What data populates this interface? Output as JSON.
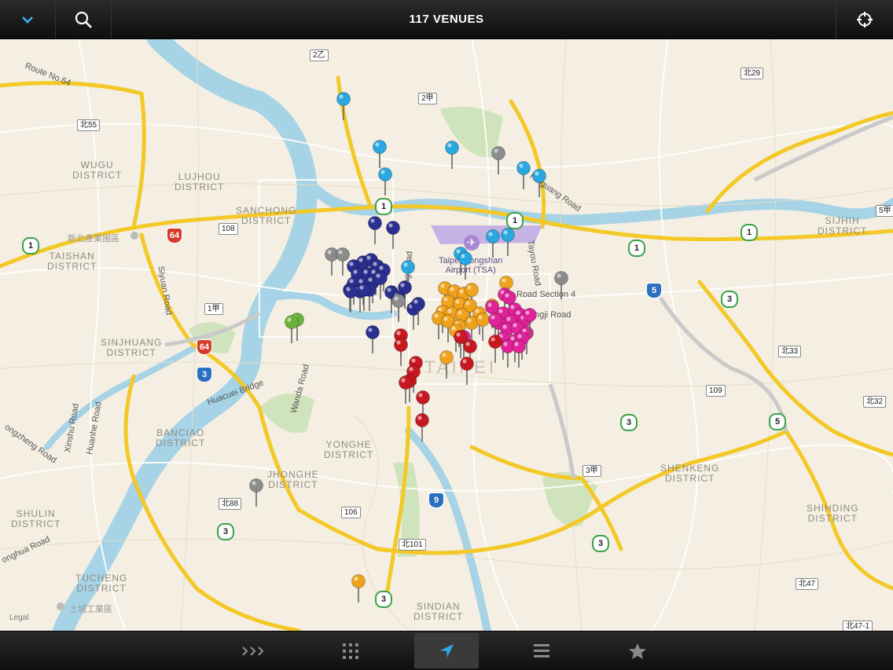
{
  "header": {
    "title": "117 VENUES"
  },
  "map": {
    "legal": "Legal",
    "city_label": "TAIPEI",
    "districts": [
      {
        "id": "wugu",
        "lines": [
          "WUGU",
          "DISTRICT"
        ]
      },
      {
        "id": "lujhou",
        "lines": [
          "LUJHOU",
          "DISTRICT"
        ]
      },
      {
        "id": "sanchong",
        "lines": [
          "SANCHONG",
          "DISTRICT"
        ]
      },
      {
        "id": "taishan",
        "lines": [
          "TAISHAN",
          "DISTRICT"
        ]
      },
      {
        "id": "sinjhuang",
        "lines": [
          "SINJHUANG",
          "DISTRICT"
        ]
      },
      {
        "id": "banciao",
        "lines": [
          "BANCIAO",
          "DISTRICT"
        ]
      },
      {
        "id": "yonghe",
        "lines": [
          "YONGHE",
          "DISTRICT"
        ]
      },
      {
        "id": "jhonghe",
        "lines": [
          "JHONGHE",
          "DISTRICT"
        ]
      },
      {
        "id": "shulin",
        "lines": [
          "SHULIN",
          "DISTRICT"
        ]
      },
      {
        "id": "tucheng",
        "lines": [
          "TUCHENG",
          "DISTRICT"
        ]
      },
      {
        "id": "sindian",
        "lines": [
          "SINDIAN",
          "DISTRICT"
        ]
      },
      {
        "id": "shenkeng",
        "lines": [
          "SHENKENG",
          "DISTRICT"
        ]
      },
      {
        "id": "shihding",
        "lines": [
          "SHIHDING",
          "DISTRICT"
        ]
      },
      {
        "id": "sijhih",
        "lines": [
          "SIJHIH",
          "DISTRICT"
        ]
      }
    ],
    "roads": [
      {
        "id": "route64",
        "text": "Route No.64"
      },
      {
        "id": "siyuan",
        "text": "Siyuan Road"
      },
      {
        "id": "huacuei",
        "text": "Huacuei Bridge"
      },
      {
        "id": "wanda",
        "text": "Wanda Road"
      },
      {
        "id": "xinshu",
        "text": "Xinshu Road"
      },
      {
        "id": "huanhe",
        "text": "Huanhe Road"
      },
      {
        "id": "zhongzheng",
        "text": "ongzheng Road"
      },
      {
        "id": "jinghua",
        "text": "onghua Road"
      },
      {
        "id": "ruiguang",
        "text": "Ruiguang Road"
      },
      {
        "id": "tayou",
        "text": "Tayou Road"
      },
      {
        "id": "linsen",
        "text": "ling Road"
      },
      {
        "id": "road_sec4",
        "text": "Road Section 4"
      },
      {
        "id": "zhongji",
        "text": "ngji Road"
      }
    ],
    "airport": {
      "line1": "Taipei Songshan",
      "line2": "Airport (TSA)"
    },
    "pois": [
      {
        "id": "poi1",
        "text": "新北產業園區"
      },
      {
        "id": "poi2",
        "text": "土城工業區"
      }
    ],
    "shields": [
      {
        "id": "s2yi",
        "text": "2乙"
      },
      {
        "id": "s2jia",
        "text": "2甲"
      },
      {
        "id": "sbei29",
        "text": "北29"
      },
      {
        "id": "sbei55",
        "text": "北55"
      },
      {
        "id": "s108",
        "text": "108"
      },
      {
        "id": "s1jia",
        "text": "1甲"
      },
      {
        "id": "s5jia",
        "text": "5甲"
      },
      {
        "id": "sbei33",
        "text": "北33"
      },
      {
        "id": "s109",
        "text": "109"
      },
      {
        "id": "sbei32",
        "text": "北32"
      },
      {
        "id": "s3jia",
        "text": "3甲"
      },
      {
        "id": "sbei88",
        "text": "北88"
      },
      {
        "id": "s106",
        "text": "106"
      },
      {
        "id": "sbei101",
        "text": "北101"
      },
      {
        "id": "sbei47",
        "text": "北47"
      },
      {
        "id": "sbei471",
        "text": "北47-1"
      }
    ],
    "route_markers": [
      {
        "id": "r1a",
        "text": "1",
        "kind": "flower"
      },
      {
        "id": "r1b",
        "text": "1",
        "kind": "flower"
      },
      {
        "id": "r1c",
        "text": "1",
        "kind": "flower"
      },
      {
        "id": "r1d",
        "text": "1",
        "kind": "flower"
      },
      {
        "id": "r1e",
        "text": "1",
        "kind": "flower"
      },
      {
        "id": "r3a",
        "text": "3",
        "kind": "flower"
      },
      {
        "id": "r3b",
        "text": "3",
        "kind": "flower"
      },
      {
        "id": "r3c",
        "text": "3",
        "kind": "flower"
      },
      {
        "id": "r3d",
        "text": "3",
        "kind": "flower"
      },
      {
        "id": "r3e",
        "text": "3",
        "kind": "flower"
      },
      {
        "id": "r5a",
        "text": "5",
        "kind": "flower"
      },
      {
        "id": "e64a",
        "text": "64",
        "kind": "expressway"
      },
      {
        "id": "e64b",
        "text": "64",
        "kind": "expressway"
      },
      {
        "id": "e3",
        "text": "3",
        "kind": "freeway"
      },
      {
        "id": "e5",
        "text": "5",
        "kind": "freeway"
      },
      {
        "id": "e9",
        "text": "9",
        "kind": "freeway"
      }
    ],
    "pin_colors": {
      "blue": "#2aa6e0",
      "navy": "#2b2f8f",
      "gray": "#8c8c8c",
      "orange": "#f0a21c",
      "magenta": "#e0239a",
      "red": "#c71820",
      "green": "#6bb23a"
    }
  },
  "tabbar": {
    "items": [
      {
        "id": "activity",
        "icon": "chevrons-icon"
      },
      {
        "id": "grid",
        "icon": "grid-icon"
      },
      {
        "id": "map",
        "icon": "location-arrow-icon",
        "active": true
      },
      {
        "id": "list",
        "icon": "list-icon"
      },
      {
        "id": "favorites",
        "icon": "star-icon"
      }
    ]
  }
}
